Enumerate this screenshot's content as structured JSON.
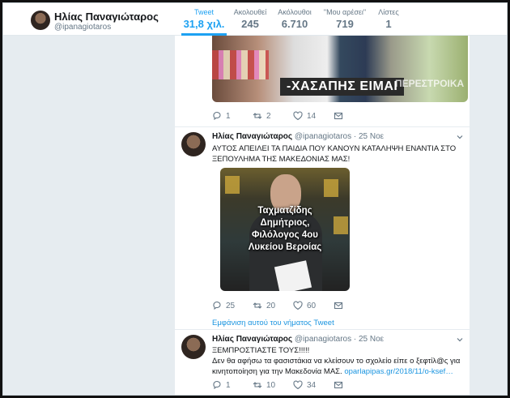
{
  "profile": {
    "name": "Ηλίας Παναγιώταρος",
    "handle": "@ipanagiotaros"
  },
  "stats": [
    {
      "label": "Tweet",
      "value": "31,8 χιλ.",
      "active": true
    },
    {
      "label": "Ακολουθεί",
      "value": "245"
    },
    {
      "label": "Ακόλουθοι",
      "value": "6.710"
    },
    {
      "label": "\"Μου αρέσει\"",
      "value": "719"
    },
    {
      "label": "Λίστες",
      "value": "1"
    }
  ],
  "top_tweet": {
    "image_caption": "-ΧΑΣΑΠΗΣ ΕΙΜΑΙ",
    "image_watermark": "ΠΕΡΕΣΤΡΟΙΚΑ",
    "replies": "1",
    "retweets": "2",
    "likes": "14"
  },
  "tweet1": {
    "name": "Ηλίας Παναγιώταρος",
    "handle": "@ipanagiotaros",
    "date": "· 25 Νοε",
    "text": "ΑΥΤΟΣ ΑΠΕΙΛΕΙ ΤΑ ΠΑΙΔΙΑ ΠΟΥ ΚΑΝΟΥΝ ΚΑΤΑΛΗΨΗ ΕΝΑΝΤΙΑ ΣΤΟ ΞΕΠΟΥΛΗΜΑ ΤΗΣ ΜΑΚΕΔΟΝΙΑΣ ΜΑΣ!",
    "photo_caption_1": "Ταχματζίδης",
    "photo_caption_2": "Δημήτριος,",
    "photo_caption_3": "Φιλόλογος 4ου",
    "photo_caption_4": "Λυκείου Βεροίας",
    "replies": "25",
    "retweets": "20",
    "likes": "60",
    "thread_link": "Εμφάνιση αυτού του νήματος Tweet"
  },
  "tweet2": {
    "name": "Ηλίας Παναγιώταρος",
    "handle": "@ipanagiotaros",
    "date": "· 25 Νοε",
    "line1": "ΞΕΜΠΡΟΣΤΙΑΣΤΕ ΤΟΥΣ!!!!!",
    "line2": "Δεν θα αφήσω τα φασιστάκια να κλείσουν το σχολείο είπε ο ξεφτίλ@ς για",
    "line3_text": "κινητοποίηση για την Μακεδονία ΜΑΣ.",
    "line3_link": "oparlapipas.gr/2018/11/ο-ksef…",
    "replies": "1",
    "retweets": "10",
    "likes": "34"
  },
  "colors": {
    "accent": "#1da1f2",
    "link": "#1b95e0",
    "muted": "#657786",
    "background": "#e6ecf0"
  }
}
